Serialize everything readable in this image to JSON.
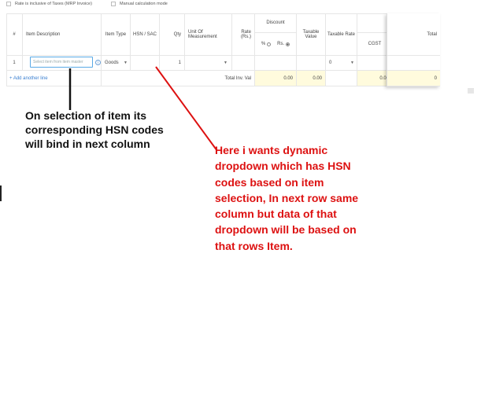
{
  "options": {
    "rate_inclusive_label": "Rate is inclusive of Taxes (MRP Invoice)",
    "manual_calc_label": "Manual calculation mode"
  },
  "table": {
    "headers": {
      "index": "#",
      "item_description": "Item Description",
      "item_type": "Item Type",
      "hsn_sac": "HSN / SAC",
      "qty": "Qty",
      "uom": "Unit Of Measurement",
      "rate": "Rate (Rs.)",
      "discount": "Discount",
      "discount_pct": "%",
      "discount_rs": "Rs.",
      "taxable_value": "Taxable Value",
      "taxable_rate": "Taxable Rate",
      "tax_group_partial": "Ta",
      "cgst": "CGST",
      "total": "Total"
    },
    "row": {
      "index": "1",
      "item_placeholder": "Select item from item master",
      "item_type": "Goods",
      "qty": "1",
      "taxable_rate": "0",
      "total": "0"
    },
    "footer": {
      "add_line": "+ Add another line",
      "total_inv_val_label": "Total Inv. Val",
      "discount_total": "0.00",
      "taxable_total": "0.00",
      "cgst_total": "0.00",
      "grand_total": "0"
    }
  },
  "annotations": {
    "black_note": "On selection of item its corresponding HSN codes will bind in next column",
    "red_note": "Here i wants dynamic dropdown which has HSN codes based on item selection, In next row same column but data of that dropdown will be based on that rows Item."
  },
  "colors": {
    "annotation_red": "#dd1111",
    "annotation_black": "#111111",
    "highlight_yellow": "#fffbdd",
    "input_focus_blue": "#59a9e6"
  }
}
